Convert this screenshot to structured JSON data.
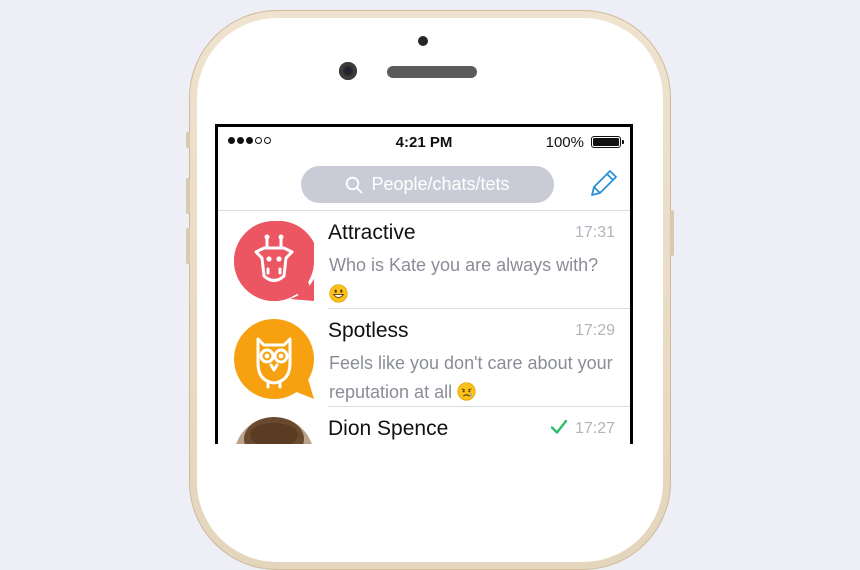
{
  "status_bar": {
    "signal_bars_filled": 3,
    "signal_bars_total": 5,
    "time": "4:21 PM",
    "battery_percent": "100%"
  },
  "search": {
    "placeholder": "People/chats/tets",
    "icon": "search-icon"
  },
  "compose": {
    "icon": "pencil-icon",
    "color": "#2e8fd6"
  },
  "chats": [
    {
      "name": "Attractive",
      "time": "17:31",
      "message": "Who is Kate you are always with?",
      "emoji": "grinning-face",
      "avatar_icon": "giraffe-icon",
      "avatar_color": "#ec5662"
    },
    {
      "name": "Spotless",
      "time": "17:29",
      "message": "Feels like you don't care about your reputation at all",
      "emoji": "sad-face",
      "avatar_icon": "owl-icon",
      "avatar_color": "#f7a010"
    },
    {
      "name": "Dion Spence",
      "time": "17:27",
      "read_receipt": "checkmark-icon",
      "avatar_icon": "photo-avatar"
    }
  ]
}
